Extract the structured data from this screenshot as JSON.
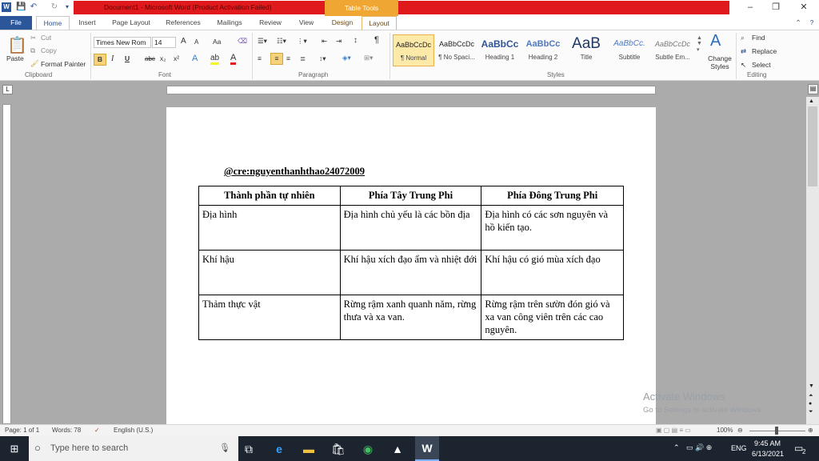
{
  "window": {
    "title": "Document1 - Microsoft Word (Product Activation Failed)",
    "contextual_tab_group": "Table Tools",
    "minimize_glyph": "–",
    "restore_glyph": "❐",
    "close_glyph": "✕"
  },
  "tabs": [
    "File",
    "Home",
    "Insert",
    "Page Layout",
    "References",
    "Mailings",
    "Review",
    "View",
    "Design",
    "Layout"
  ],
  "active_tab": "Home",
  "ribbon": {
    "clipboard": {
      "paste": "Paste",
      "cut": "Cut",
      "copy": "Copy",
      "format_painter": "Format Painter",
      "group": "Clipboard"
    },
    "font": {
      "name": "Times New Rom",
      "size": "14",
      "grow": "A",
      "shrink": "A",
      "change_case": "Aa",
      "bold": "B",
      "italic": "I",
      "underline": "U",
      "strike": "abc",
      "subscript": "x₂",
      "superscript": "x²",
      "group": "Font"
    },
    "paragraph": {
      "group": "Paragraph"
    },
    "styles": {
      "items": [
        {
          "preview": "AaBbCcDc",
          "name": "¶ Normal"
        },
        {
          "preview": "AaBbCcDc",
          "name": "¶ No Spaci..."
        },
        {
          "preview": "AaBbCc",
          "name": "Heading 1"
        },
        {
          "preview": "AaBbCc",
          "name": "Heading 2"
        },
        {
          "preview": "AaB",
          "name": "Title"
        },
        {
          "preview": "AaBbCc.",
          "name": "Subtitle"
        },
        {
          "preview": "AaBbCcDc",
          "name": "Subtle Em..."
        }
      ],
      "change_styles": "Change Styles",
      "group": "Styles"
    },
    "editing": {
      "find": "Find",
      "replace": "Replace",
      "select": "Select",
      "group": "Editing"
    }
  },
  "document": {
    "author_line": "@cre:nguyenthanhthao24072009",
    "table": {
      "headers": [
        "Thành phần tự nhiên",
        "Phía Tây Trung Phi",
        "Phía Đông Trung Phi"
      ],
      "rows": [
        [
          "Địa hình",
          "Địa hình chủ yếu là các bồn địa",
          "Địa hình có các sơn nguyên và hồ kiến tạo."
        ],
        [
          "Khí hậu",
          "Khí hậu xích đạo ẩm và nhiệt đới",
          "Khí hậu có gió mùa xích đạo"
        ],
        [
          "Thảm thực vật",
          "Rừng rậm xanh quanh năm, rừng thưa và xa van.",
          "Rừng rậm trên sườn đón gió và xa van công viên trên các cao nguyên."
        ]
      ]
    }
  },
  "watermark": {
    "line1": "Activate Windows",
    "line2": "Go to Settings to activate Windows."
  },
  "statusbar": {
    "page": "Page: 1 of 1",
    "words": "Words: 78",
    "language": "English (U.S.)",
    "zoom": "100%"
  },
  "taskbar": {
    "search_placeholder": "Type here to search",
    "language": "ENG",
    "time": "9:45 AM",
    "date": "6/13/2021",
    "notifications": "2"
  },
  "colors": {
    "title_bar_red": "#e0191c",
    "table_tools_orange": "#f0a632",
    "file_tab_blue": "#2b579a",
    "taskbar": "#1c2430"
  }
}
